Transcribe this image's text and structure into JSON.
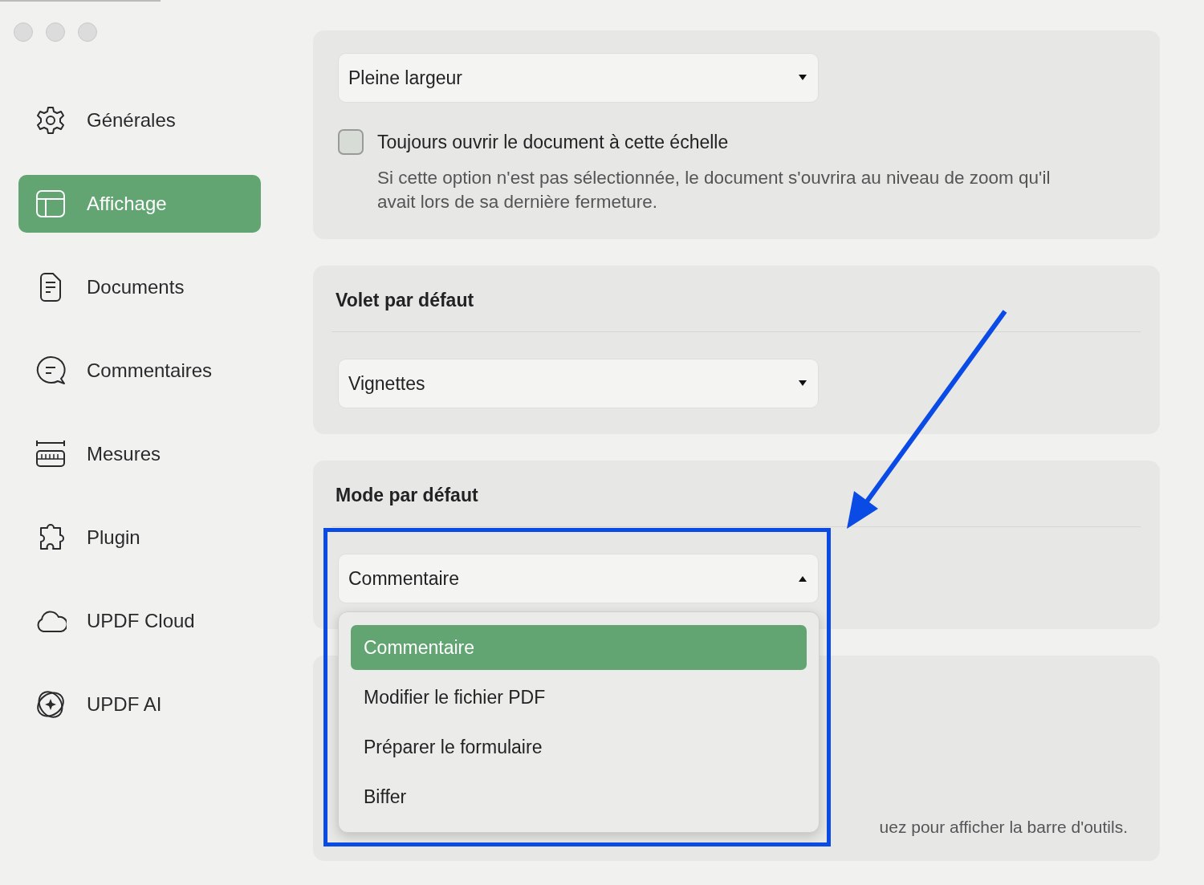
{
  "sidebar": {
    "items": [
      {
        "label": "Générales",
        "kind": "gear",
        "selected": false
      },
      {
        "label": "Affichage",
        "kind": "layout",
        "selected": true
      },
      {
        "label": "Documents",
        "kind": "document",
        "selected": false
      },
      {
        "label": "Commentaires",
        "kind": "comment",
        "selected": false
      },
      {
        "label": "Mesures",
        "kind": "ruler",
        "selected": false
      },
      {
        "label": "Plugin",
        "kind": "puzzle",
        "selected": false
      },
      {
        "label": "UPDF Cloud",
        "kind": "cloud",
        "selected": false
      },
      {
        "label": "UPDF AI",
        "kind": "sparkle",
        "selected": false
      }
    ]
  },
  "zoom_section": {
    "dropdown": {
      "value": "Pleine largeur",
      "expanded": false
    },
    "checkbox": {
      "label": "Toujours ouvrir le document à cette échelle",
      "checked": false
    },
    "note": "Si cette option n'est pas sélectionnée, le document s'ouvrira au niveau de zoom qu'il avait lors de sa dernière fermeture."
  },
  "default_pane": {
    "title": "Volet par défaut",
    "dropdown": {
      "value": "Vignettes",
      "expanded": false
    }
  },
  "default_mode": {
    "title": "Mode par défaut",
    "dropdown": {
      "value": "Commentaire",
      "expanded": true
    },
    "menu": [
      {
        "label": "Commentaire",
        "selected": true
      },
      {
        "label": "Modifier le fichier PDF",
        "selected": false
      },
      {
        "label": "Préparer le formulaire",
        "selected": false
      },
      {
        "label": "Biffer",
        "selected": false
      }
    ]
  },
  "toolbar_section": {
    "note": "uez pour afficher la barre d'outils."
  }
}
